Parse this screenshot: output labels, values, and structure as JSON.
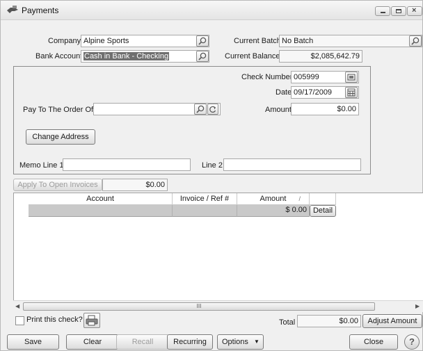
{
  "window": {
    "title": "Payments",
    "icon": "payment-hand-icon"
  },
  "header": {
    "company_label": "Company",
    "company_value": "Alpine Sports",
    "bank_label": "Bank Account",
    "bank_value": "Cash in Bank - Checking",
    "batch_label": "Current Batch",
    "batch_value": "No Batch",
    "balance_label": "Current Balance",
    "balance_value": "$2,085,642.79"
  },
  "check": {
    "number_label": "Check Number",
    "number_value": "005999",
    "date_label": "Date",
    "date_value": "09/17/2009",
    "payee_label": "Pay To The Order Of",
    "payee_value": "",
    "amount_label": "Amount",
    "amount_value": "$0.00",
    "change_address_label": "Change Address",
    "memo1_label": "Memo Line 1",
    "memo1_value": "",
    "memo2_label": "Line 2",
    "memo2_value": ""
  },
  "apply": {
    "label": "Apply To Open Invoices",
    "value": "$0.00"
  },
  "grid": {
    "columns": [
      "Account",
      "Invoice / Ref #",
      "Amount"
    ],
    "sort_indicator": "/",
    "rows": [
      {
        "account": "",
        "invoice": "",
        "amount": "$ 0.00",
        "detail_label": "Detail"
      }
    ],
    "scroll_mark": "III"
  },
  "footer": {
    "print_label": "Print this check?",
    "print_checked": false,
    "total_label": "Total",
    "total_value": "$0.00",
    "adjust_label": "Adjust Amount",
    "buttons": {
      "save": "Save",
      "clear": "Clear",
      "recall": "Recall",
      "recurring": "Recurring",
      "options": "Options",
      "close": "Close"
    }
  },
  "colors": {
    "window_bg": "#f0f0f0",
    "grid_row": "#c9c9c9",
    "selection": "#6f6f6f"
  }
}
